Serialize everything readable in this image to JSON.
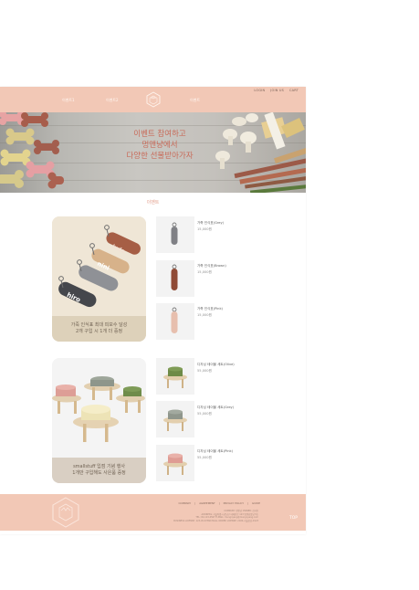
{
  "header": {
    "utility": [
      "LOGIN",
      "JOIN US",
      "CART"
    ],
    "nav": [
      "이벤트1",
      "이벤트2",
      "이벤트"
    ]
  },
  "hero": {
    "lines": [
      "이벤트 참여하고",
      "멍앤냥에서",
      "다양한 선물받아가자"
    ]
  },
  "section": {
    "title": "이벤트"
  },
  "features": [
    {
      "lines": [
        "가죽 인식표 최대 피보수 달성",
        "2개 구입 시 1개 더 증정"
      ],
      "tags": [
        "luda",
        "nini",
        "hiro"
      ]
    },
    {
      "lines": [
        "smallstuff 입점 기념 행사",
        "1개만 구입해도 사은품 증정"
      ]
    }
  ],
  "products": [
    {
      "name": "가죽 인식표(Grey)",
      "price": "15,000원"
    },
    {
      "name": "가죽 인식표(Brown)",
      "price": "15,000원"
    },
    {
      "name": "가죽 인식표(Pink)",
      "price": "15,000원"
    },
    {
      "name": "디자닝 테이블 세트(Olive)",
      "price": "55,000원"
    },
    {
      "name": "디자닝 테이블 세트(Grey)",
      "price": "55,000원"
    },
    {
      "name": "디자닝 테이블 세트(Pink)",
      "price": "55,000원"
    }
  ],
  "footer": {
    "links": [
      "COMPANY",
      "AGREEMENT",
      "PRIVACY POLICY",
      "GUIDE"
    ],
    "info": [
      "COMPANY: 멍앤냥 OWNER: 김사랑",
      "ADDRESS: 서울특별시 강남구 테헤란로 123 멍앤냥빌딩 5층",
      "TEL: 02-123-4567 E-MAIL: mungnyang@mungnyang.com",
      "BUSINESS LICENSE: 123-45-67890 MALL ORDER LICENSE: 2024-서울강남-0123"
    ],
    "top": "TOP"
  }
}
